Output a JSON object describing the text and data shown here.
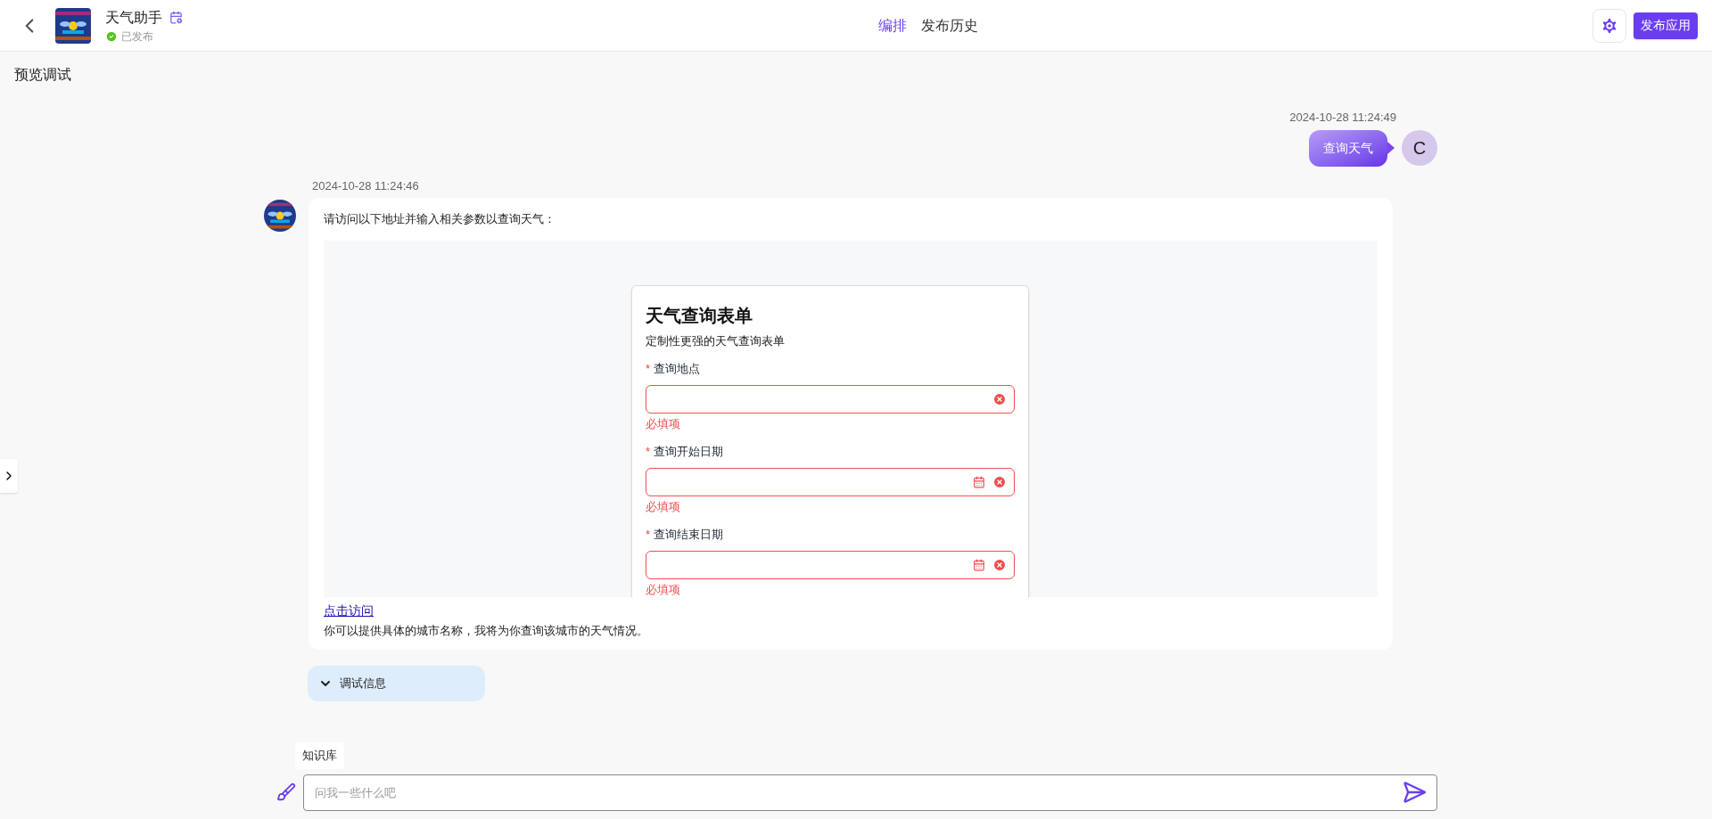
{
  "header": {
    "app_name": "天气助手",
    "status": "已发布",
    "published": true,
    "tabs": [
      {
        "label": "编排",
        "selected": true
      },
      {
        "label": "发布历史",
        "selected": false
      }
    ],
    "publish_button": "发布应用"
  },
  "panel_title": "预览调试",
  "messages": [
    {
      "kind": "user",
      "time": "2024-10-28 11:24:49",
      "text": "查询天气",
      "avatar_letter": "C"
    },
    {
      "kind": "bot",
      "time": "2024-10-28 11:24:46",
      "intro": "请访问以下地址并输入相关参数以查询天气：",
      "form": {
        "title": "天气查询表单",
        "subtitle": "定制性更强的天气查询表单",
        "fields": [
          {
            "label": "查询地点",
            "required_mark": "*",
            "kind": "text",
            "error": "必填项"
          },
          {
            "label": "查询开始日期",
            "required_mark": "*",
            "kind": "date",
            "error": "必填项"
          },
          {
            "label": "查询结束日期",
            "required_mark": "*",
            "kind": "date",
            "error": "必填项"
          }
        ]
      },
      "link": "点击访问",
      "outro": "你可以提供具体的城市名称，我将为你查询该城市的天气情况。"
    }
  ],
  "debug": {
    "label": "调试信息",
    "expanded": false
  },
  "knowledge_tag": "知识库",
  "input": {
    "placeholder": "问我一些什么吧"
  }
}
